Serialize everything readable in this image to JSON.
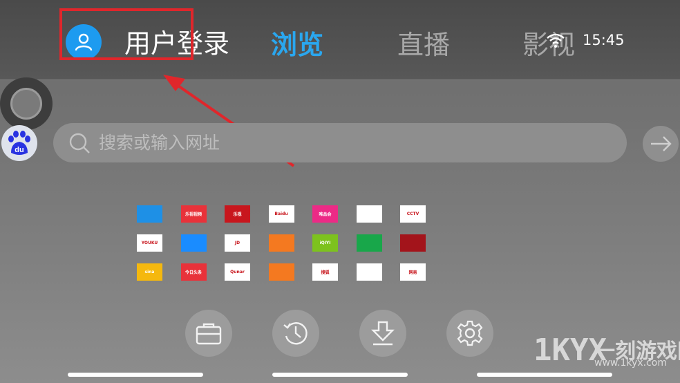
{
  "header": {
    "login_label": "用户登录",
    "tabs": [
      {
        "label": "浏览",
        "active": true
      },
      {
        "label": "直播",
        "active": false
      },
      {
        "label": "影视",
        "active": false
      }
    ],
    "time": "15:45",
    "accent_color": "#2aa7ef",
    "highlight_color": "#e0262b"
  },
  "search": {
    "placeholder": "搜索或输入网址",
    "engine_icon": "baidu-du-icon"
  },
  "sites": [
    {
      "label": "",
      "color": "#1e90e6",
      "name": "site-tile-1"
    },
    {
      "label": "乐视视频",
      "color": "#e8323a",
      "name": "site-tile-2"
    },
    {
      "label": "乐视",
      "color": "#c8161d",
      "name": "site-tile-3"
    },
    {
      "label": "Baidu",
      "color": "#ffffff",
      "name": "site-tile-4"
    },
    {
      "label": "唯品会",
      "color": "#ec2a86",
      "name": "site-tile-5"
    },
    {
      "label": "",
      "color": "#ffffff",
      "name": "site-tile-6"
    },
    {
      "label": "CCTV",
      "color": "#ffffff",
      "name": "site-tile-7"
    },
    {
      "label": "YOUKU",
      "color": "#ffffff",
      "name": "site-tile-8"
    },
    {
      "label": "",
      "color": "#1a8cff",
      "name": "site-tile-9"
    },
    {
      "label": "JD",
      "color": "#ffffff",
      "name": "site-tile-10"
    },
    {
      "label": "",
      "color": "#f47920",
      "name": "site-tile-11"
    },
    {
      "label": "iQIYI",
      "color": "#7dc21e",
      "name": "site-tile-12"
    },
    {
      "label": "",
      "color": "#18a74a",
      "name": "site-tile-13"
    },
    {
      "label": "",
      "color": "#a3141b",
      "name": "site-tile-14"
    },
    {
      "label": "sina",
      "color": "#f5b80e",
      "name": "site-tile-15"
    },
    {
      "label": "今日头条",
      "color": "#e8323a",
      "name": "site-tile-16"
    },
    {
      "label": "Qunar",
      "color": "#ffffff",
      "name": "site-tile-17"
    },
    {
      "label": "",
      "color": "#f47920",
      "name": "site-tile-18"
    },
    {
      "label": "搜狐",
      "color": "#ffffff",
      "name": "site-tile-19"
    },
    {
      "label": "",
      "color": "#ffffff",
      "name": "site-tile-20"
    },
    {
      "label": "网易",
      "color": "#ffffff",
      "name": "site-tile-21"
    }
  ],
  "toolbar": [
    {
      "icon": "folder-icon"
    },
    {
      "icon": "history-icon"
    },
    {
      "icon": "download-icon"
    },
    {
      "icon": "gear-icon"
    }
  ],
  "watermark": {
    "text": "一刻游戏网",
    "url": "www.1kyx.com",
    "logo": "1KYX"
  }
}
